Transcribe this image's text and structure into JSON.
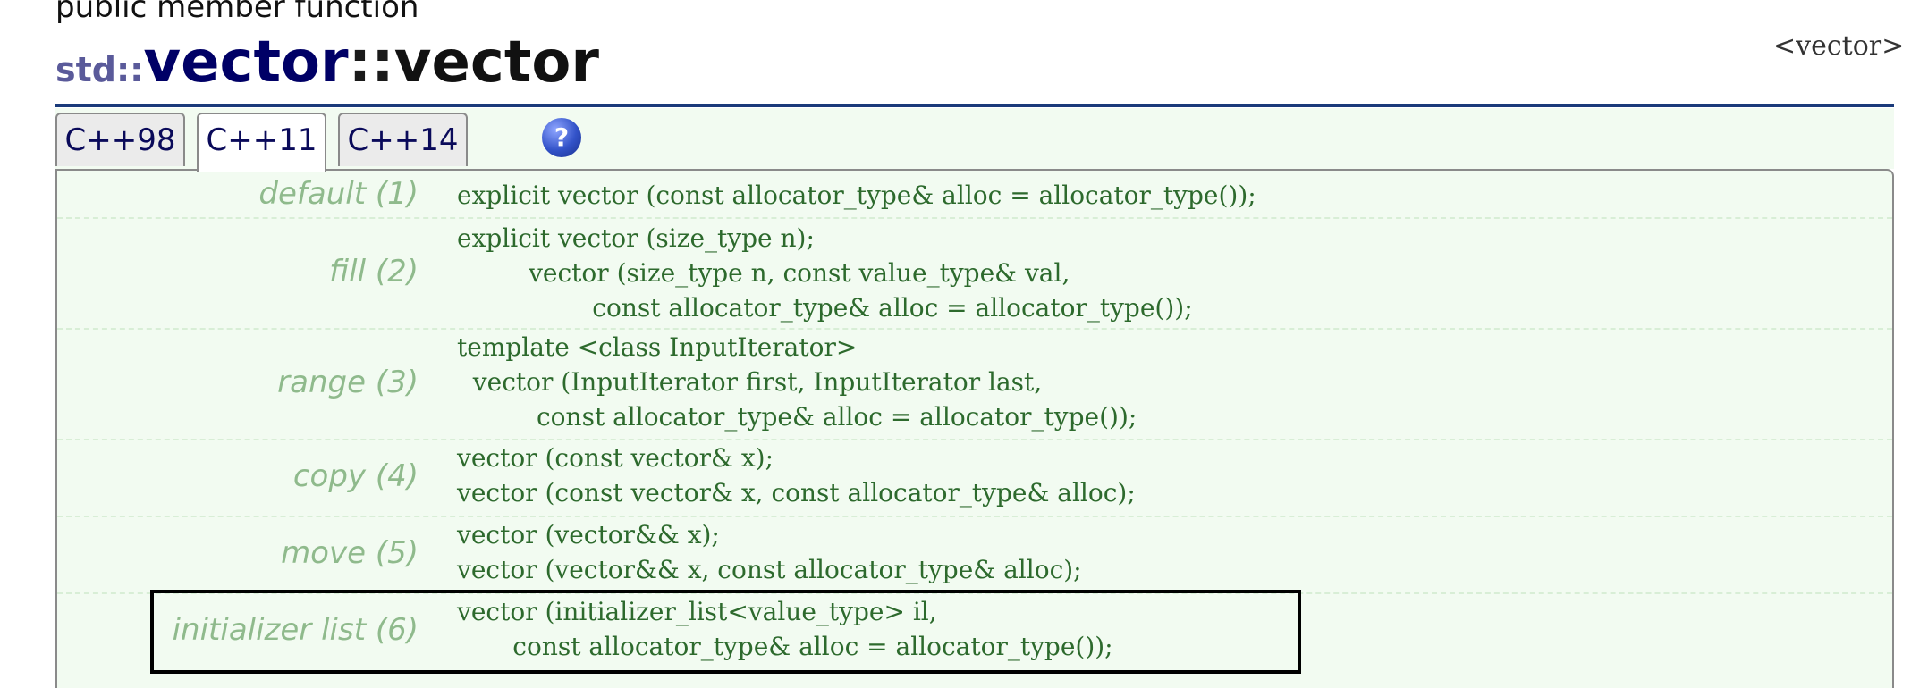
{
  "header": {
    "kind": "public member function",
    "namespace": "std::",
    "class_name": "vector",
    "separator": "::",
    "function_name": "vector",
    "header_tag": "<vector>"
  },
  "tabs": [
    {
      "label": "C++98",
      "active": false
    },
    {
      "label": "C++11",
      "active": true
    },
    {
      "label": "C++14",
      "active": false
    }
  ],
  "help": {
    "label": "?"
  },
  "constructors": [
    {
      "label": "default (1)",
      "code": "explicit vector (const allocator_type& alloc = allocator_type());"
    },
    {
      "label": "fill (2)",
      "code": "explicit vector (size_type n);\n         vector (size_type n, const value_type& val,\n                 const allocator_type& alloc = allocator_type());"
    },
    {
      "label": "range (3)",
      "code": "template <class InputIterator>\n  vector (InputIterator first, InputIterator last,\n          const allocator_type& alloc = allocator_type());"
    },
    {
      "label": "copy (4)",
      "code": "vector (const vector& x);\nvector (const vector& x, const allocator_type& alloc);"
    },
    {
      "label": "move (5)",
      "code": "vector (vector&& x);\nvector (vector&& x, const allocator_type& alloc);"
    },
    {
      "label": "initializer list (6)",
      "code": "vector (initializer_list<value_type> il,\n       const allocator_type& alloc = allocator_type());",
      "highlighted": true
    }
  ],
  "colors": {
    "panel_bg": "#f2fbf1",
    "label": "#8fba8c",
    "code": "#2d6a2d",
    "rule": "#1a3a7a",
    "highlight_border": "#000000"
  }
}
